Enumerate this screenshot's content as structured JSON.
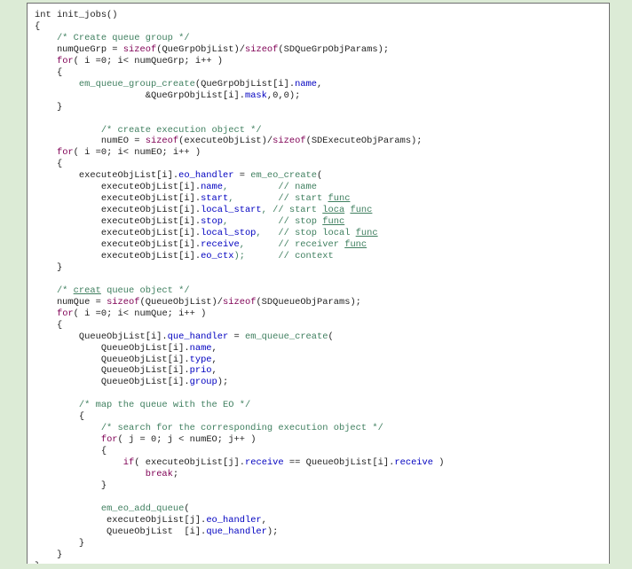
{
  "code": {
    "lines": [
      [
        {
          "t": "int init_jobs()",
          "c": ""
        }
      ],
      [
        {
          "t": "{",
          "c": ""
        }
      ],
      [
        {
          "t": "    /* Create queue group */",
          "c": "cm"
        }
      ],
      [
        {
          "t": "    numQueGrp = ",
          "c": ""
        },
        {
          "t": "sizeof",
          "c": "kw"
        },
        {
          "t": "(QueGrpObjList)/",
          "c": ""
        },
        {
          "t": "sizeof",
          "c": "kw"
        },
        {
          "t": "(SDQueGrpObjParams);",
          "c": ""
        }
      ],
      [
        {
          "t": "    ",
          "c": ""
        },
        {
          "t": "for",
          "c": "kw"
        },
        {
          "t": "( i =0; i< numQueGrp; i++ )",
          "c": ""
        }
      ],
      [
        {
          "t": "    {",
          "c": ""
        }
      ],
      [
        {
          "t": "        ",
          "c": ""
        },
        {
          "t": "em_queue_group_create",
          "c": "fn"
        },
        {
          "t": "(QueGrpObjList[i].",
          "c": ""
        },
        {
          "t": "name",
          "c": "fld"
        },
        {
          "t": ",",
          "c": ""
        }
      ],
      [
        {
          "t": "                    &QueGrpObjList[i].",
          "c": ""
        },
        {
          "t": "mask",
          "c": "fld"
        },
        {
          "t": ",0,0);",
          "c": ""
        }
      ],
      [
        {
          "t": "    }",
          "c": ""
        }
      ],
      [
        {
          "t": "",
          "c": ""
        }
      ],
      [
        {
          "t": "            /* create execution object */",
          "c": "cm"
        }
      ],
      [
        {
          "t": "            numEO = ",
          "c": ""
        },
        {
          "t": "sizeof",
          "c": "kw"
        },
        {
          "t": "(executeObjList)/",
          "c": ""
        },
        {
          "t": "sizeof",
          "c": "kw"
        },
        {
          "t": "(SDExecuteObjParams);",
          "c": ""
        }
      ],
      [
        {
          "t": "    ",
          "c": ""
        },
        {
          "t": "for",
          "c": "kw"
        },
        {
          "t": "( i =0; i< numEO; i++ )",
          "c": ""
        }
      ],
      [
        {
          "t": "    {",
          "c": ""
        }
      ],
      [
        {
          "t": "        executeObjList[i].",
          "c": ""
        },
        {
          "t": "eo_handler",
          "c": "fld"
        },
        {
          "t": " = ",
          "c": ""
        },
        {
          "t": "em_eo_create",
          "c": "fn"
        },
        {
          "t": "(",
          "c": ""
        }
      ],
      [
        {
          "t": "            executeObjList[i].",
          "c": ""
        },
        {
          "t": "name",
          "c": "fld"
        },
        {
          "t": ",         // name",
          "c": "cm0"
        }
      ],
      [
        {
          "t": "            executeObjList[i].",
          "c": ""
        },
        {
          "t": "start",
          "c": "fld"
        },
        {
          "t": ",        // start ",
          "c": "cm0"
        },
        {
          "t": "func",
          "c": "ul"
        }
      ],
      [
        {
          "t": "            executeObjList[i].",
          "c": ""
        },
        {
          "t": "local_start",
          "c": "fld"
        },
        {
          "t": ", // start ",
          "c": "cm0"
        },
        {
          "t": "loca",
          "c": "ul"
        },
        {
          "t": " ",
          "c": "cm"
        },
        {
          "t": "func",
          "c": "ul"
        }
      ],
      [
        {
          "t": "            executeObjList[i].",
          "c": ""
        },
        {
          "t": "stop",
          "c": "fld"
        },
        {
          "t": ",         // stop ",
          "c": "cm0"
        },
        {
          "t": "func",
          "c": "ul"
        }
      ],
      [
        {
          "t": "            executeObjList[i].",
          "c": ""
        },
        {
          "t": "local_stop",
          "c": "fld"
        },
        {
          "t": ",   // stop local ",
          "c": "cm0"
        },
        {
          "t": "func",
          "c": "ul"
        }
      ],
      [
        {
          "t": "            executeObjList[i].",
          "c": ""
        },
        {
          "t": "receive",
          "c": "fld"
        },
        {
          "t": ",      // receiver ",
          "c": "cm0"
        },
        {
          "t": "func",
          "c": "ul"
        }
      ],
      [
        {
          "t": "            executeObjList[i].",
          "c": ""
        },
        {
          "t": "eo_ctx",
          "c": "fld"
        },
        {
          "t": ");      // context",
          "c": "cm0"
        }
      ],
      [
        {
          "t": "    }",
          "c": ""
        }
      ],
      [
        {
          "t": "",
          "c": ""
        }
      ],
      [
        {
          "t": "    /* ",
          "c": "cm"
        },
        {
          "t": "creat",
          "c": "ul"
        },
        {
          "t": " queue object */",
          "c": "cm"
        }
      ],
      [
        {
          "t": "    numQue = ",
          "c": ""
        },
        {
          "t": "sizeof",
          "c": "kw"
        },
        {
          "t": "(QueueObjList)/",
          "c": ""
        },
        {
          "t": "sizeof",
          "c": "kw"
        },
        {
          "t": "(SDQueueObjParams);",
          "c": ""
        }
      ],
      [
        {
          "t": "    ",
          "c": ""
        },
        {
          "t": "for",
          "c": "kw"
        },
        {
          "t": "( i =0; i< numQue; i++ )",
          "c": ""
        }
      ],
      [
        {
          "t": "    {",
          "c": ""
        }
      ],
      [
        {
          "t": "        QueueObjList[i].",
          "c": ""
        },
        {
          "t": "que_handler",
          "c": "fld"
        },
        {
          "t": " = ",
          "c": ""
        },
        {
          "t": "em_queue_create",
          "c": "fn"
        },
        {
          "t": "(",
          "c": ""
        }
      ],
      [
        {
          "t": "            QueueObjList[i].",
          "c": ""
        },
        {
          "t": "name",
          "c": "fld"
        },
        {
          "t": ",",
          "c": ""
        }
      ],
      [
        {
          "t": "            QueueObjList[i].",
          "c": ""
        },
        {
          "t": "type",
          "c": "fld"
        },
        {
          "t": ",",
          "c": ""
        }
      ],
      [
        {
          "t": "            QueueObjList[i].",
          "c": ""
        },
        {
          "t": "prio",
          "c": "fld"
        },
        {
          "t": ",",
          "c": ""
        }
      ],
      [
        {
          "t": "            QueueObjList[i].",
          "c": ""
        },
        {
          "t": "group",
          "c": "fld"
        },
        {
          "t": ");",
          "c": ""
        }
      ],
      [
        {
          "t": "",
          "c": ""
        }
      ],
      [
        {
          "t": "        /* map the queue with the EO */",
          "c": "cm"
        }
      ],
      [
        {
          "t": "        {",
          "c": ""
        }
      ],
      [
        {
          "t": "            /* search for the corresponding execution object */",
          "c": "cm"
        }
      ],
      [
        {
          "t": "            ",
          "c": ""
        },
        {
          "t": "for",
          "c": "kw"
        },
        {
          "t": "( j = 0; j < numEO; j++ )",
          "c": ""
        }
      ],
      [
        {
          "t": "            {",
          "c": ""
        }
      ],
      [
        {
          "t": "                ",
          "c": ""
        },
        {
          "t": "if",
          "c": "kw"
        },
        {
          "t": "( executeObjList[j].",
          "c": ""
        },
        {
          "t": "receive",
          "c": "fld"
        },
        {
          "t": " == QueueObjList[i].",
          "c": ""
        },
        {
          "t": "receive",
          "c": "fld"
        },
        {
          "t": " )",
          "c": ""
        }
      ],
      [
        {
          "t": "                    ",
          "c": ""
        },
        {
          "t": "break",
          "c": "kw"
        },
        {
          "t": ";",
          "c": ""
        }
      ],
      [
        {
          "t": "            }",
          "c": ""
        }
      ],
      [
        {
          "t": "",
          "c": ""
        }
      ],
      [
        {
          "t": "            ",
          "c": ""
        },
        {
          "t": "em_eo_add_queue",
          "c": "fn"
        },
        {
          "t": "(",
          "c": ""
        }
      ],
      [
        {
          "t": "             executeObjList[j].",
          "c": ""
        },
        {
          "t": "eo_handler",
          "c": "fld"
        },
        {
          "t": ",",
          "c": ""
        }
      ],
      [
        {
          "t": "             QueueObjList  [i].",
          "c": ""
        },
        {
          "t": "que_handler",
          "c": "fld"
        },
        {
          "t": ");",
          "c": ""
        }
      ],
      [
        {
          "t": "        }",
          "c": ""
        }
      ],
      [
        {
          "t": "    }",
          "c": ""
        }
      ],
      [
        {
          "t": "}",
          "c": ""
        }
      ]
    ]
  }
}
